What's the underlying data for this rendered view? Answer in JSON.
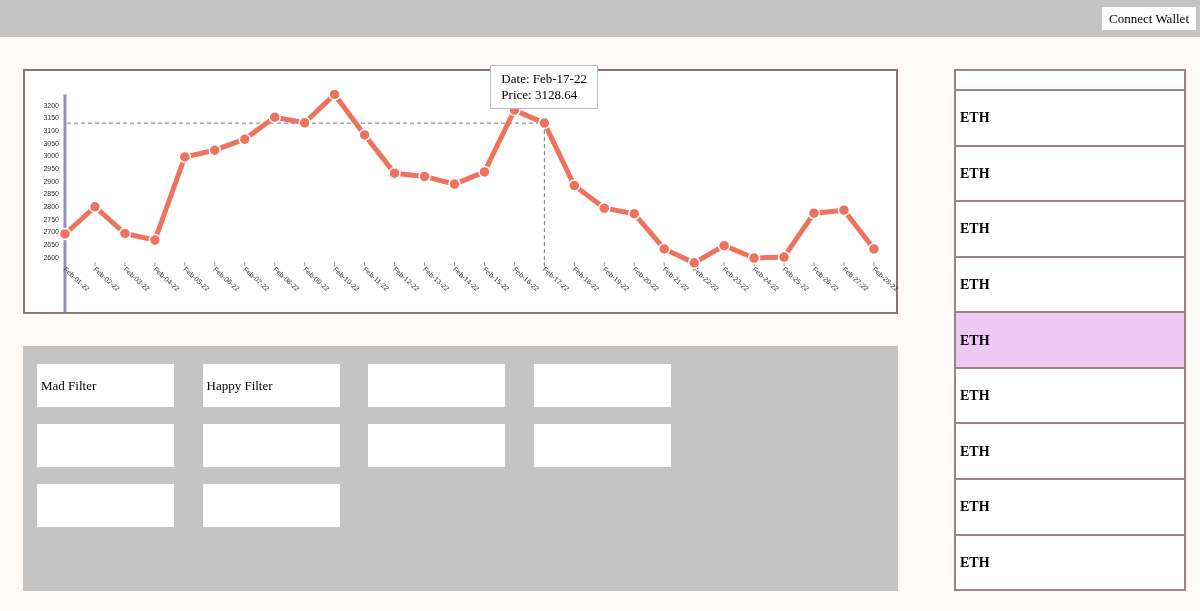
{
  "header": {
    "button": "Connect Wallet"
  },
  "chart": {
    "tooltip": {
      "date": "Date: Feb-17-22",
      "price": "Price: 3128.64"
    },
    "chart_data": {
      "type": "line",
      "categories": [
        "Feb-01-22",
        "Feb-02-22",
        "Feb-03-22",
        "Feb-04-22",
        "Feb-05-22",
        "Feb-06-22",
        "Feb-07-22",
        "Feb-08-22",
        "Feb-09-22",
        "Feb-10-22",
        "Feb-11-22",
        "Feb-12-22",
        "Feb-13-22",
        "Feb-14-22",
        "Feb-15-22",
        "Feb-16-22",
        "Feb-17-22",
        "Feb-18-22",
        "Feb-19-22",
        "Feb-20-22",
        "Feb-21-22",
        "Feb-22-22",
        "Feb-23-22",
        "Feb-24-22",
        "Feb-25-22",
        "Feb-26-22",
        "Feb-27-22",
        "Feb-28-22"
      ],
      "series": [
        {
          "color": "#ee735f",
          "marker": "circle",
          "values": [
            2691,
            2798,
            2693,
            2667,
            2995,
            3022,
            3065,
            3152,
            3130,
            3242,
            3082,
            2931,
            2918,
            2888,
            2936,
            3180,
            3128.64,
            2882,
            2793,
            2771,
            2632,
            2577,
            2645,
            2596,
            2600,
            2773,
            2785,
            2632
          ]
        }
      ],
      "ylim": [
        2383,
        3242
      ],
      "yticks": [
        2600,
        2650,
        2700,
        2750,
        2800,
        2850,
        2900,
        2950,
        3000,
        3050,
        3100,
        3150,
        3200
      ],
      "ref_lines": [
        {
          "axis": "y",
          "value": 3128.64
        },
        {
          "axis": "x",
          "value": "Feb-17-22"
        }
      ]
    }
  },
  "filters": [
    {
      "kind": "labeled",
      "label": "Mad Filter"
    },
    {
      "kind": "labeled",
      "label": "Happy Filter"
    },
    {
      "kind": "empty"
    },
    {
      "kind": "empty"
    },
    {
      "kind": "empty"
    },
    {
      "kind": "empty"
    },
    {
      "kind": "empty"
    },
    {
      "kind": "empty"
    },
    {
      "kind": "empty"
    },
    {
      "kind": "empty"
    }
  ],
  "assets": [
    {
      "symbol": "ETH",
      "selected": false
    },
    {
      "symbol": "ETH",
      "selected": false
    },
    {
      "symbol": "ETH",
      "selected": false
    },
    {
      "symbol": "ETH",
      "selected": false
    },
    {
      "symbol": "ETH",
      "selected": true
    },
    {
      "symbol": "ETH",
      "selected": false
    },
    {
      "symbol": "ETH",
      "selected": false
    },
    {
      "symbol": "ETH",
      "selected": false
    },
    {
      "symbol": "ETH",
      "selected": false
    }
  ]
}
